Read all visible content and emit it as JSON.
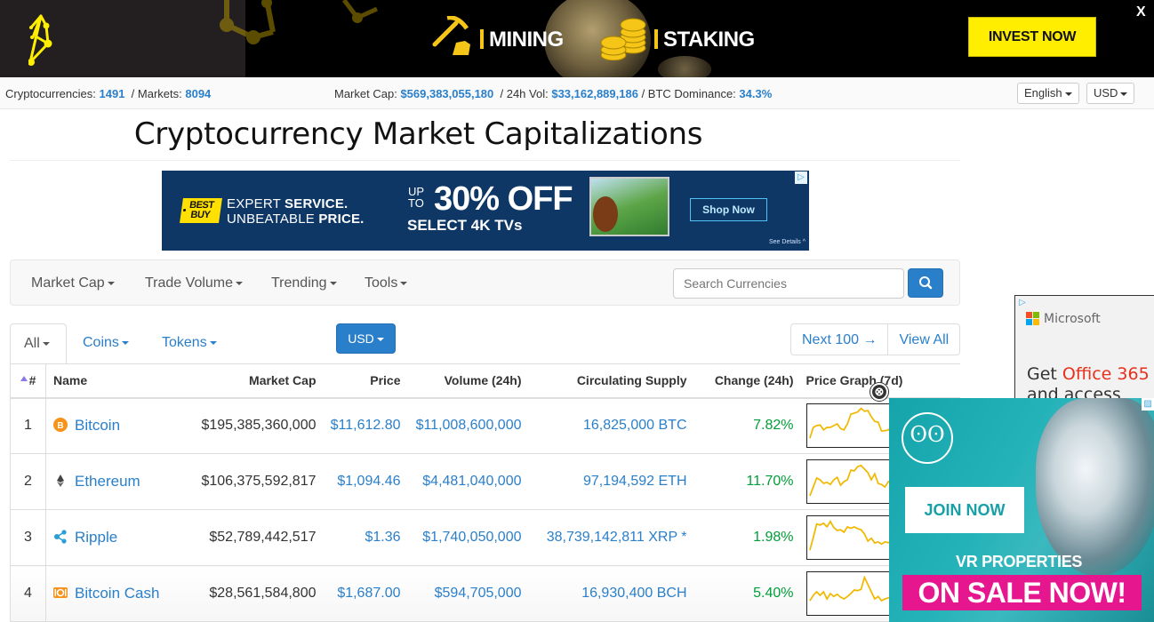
{
  "top_ad": {
    "mining_label": "MINING",
    "staking_label": "STAKING",
    "cta_label": "INVEST NOW",
    "close_label": "X",
    "accent_color": "#ffee00"
  },
  "stats": {
    "cryptocurrencies_label": "Cryptocurrencies:",
    "cryptocurrencies_value": "1491",
    "markets_label": "/ Markets:",
    "markets_value": "8094",
    "market_cap_label": "Market Cap:",
    "market_cap_value": "$569,383,055,180",
    "vol_label": "/ 24h Vol:",
    "vol_value": "$33,162,889,186",
    "btc_dom_label": "/ BTC Dominance:",
    "btc_dom_value": "34.3%",
    "language_selected": "English",
    "currency_selected": "USD"
  },
  "page_title": "Cryptocurrency Market Capitalizations",
  "bestbuy_ad": {
    "brand_line1": "BEST",
    "brand_line2": "BUY",
    "tagline_line1_light": "EXPERT ",
    "tagline_line1_bold": "SERVICE.",
    "tagline_line2_light": "UNBEATABLE ",
    "tagline_line2_bold": "PRICE.",
    "up_to": "UP TO",
    "discount": "30% OFF",
    "product": "SELECT 4K TVs",
    "cta": "Shop Now",
    "see_details": "See Details ^"
  },
  "nav": {
    "items": [
      {
        "label": "Market Cap"
      },
      {
        "label": "Trade Volume"
      },
      {
        "label": "Trending"
      },
      {
        "label": "Tools"
      }
    ],
    "search_placeholder": "Search Currencies"
  },
  "filters": {
    "tabs": [
      {
        "label": "All",
        "active": true
      },
      {
        "label": "Coins",
        "active": false
      },
      {
        "label": "Tokens",
        "active": false
      }
    ],
    "currency_button": "USD",
    "next_label": "Next 100 →",
    "view_all_label": "View All"
  },
  "table": {
    "columns": [
      "#",
      "Name",
      "Market Cap",
      "Price",
      "Volume (24h)",
      "Circulating Supply",
      "Change (24h)",
      "Price Graph (7d)"
    ],
    "rows": [
      {
        "rank": "1",
        "name": "Bitcoin",
        "icon": "bitcoin-icon",
        "market_cap": "$195,385,360,000",
        "price": "$11,612.80",
        "volume": "$11,008,600,000",
        "supply": "16,825,000 BTC",
        "change": "7.82%",
        "spark": [
          0.15,
          0.45,
          0.5,
          0.52,
          0.38,
          0.45,
          0.45,
          0.5,
          0.55,
          0.42,
          0.38,
          0.55,
          0.82,
          0.85,
          0.88,
          0.98,
          0.9,
          0.92,
          0.75,
          0.62,
          0.6,
          0.35,
          0.36,
          0.38,
          0.48
        ]
      },
      {
        "rank": "2",
        "name": "Ethereum",
        "icon": "ethereum-icon",
        "market_cap": "$106,375,592,817",
        "price": "$1,094.46",
        "volume": "$4,481,040,000",
        "supply": "97,194,592 ETH",
        "change": "11.70%",
        "spark": [
          0.1,
          0.35,
          0.6,
          0.55,
          0.45,
          0.48,
          0.42,
          0.55,
          0.62,
          0.4,
          0.5,
          0.55,
          0.82,
          0.8,
          0.92,
          0.95,
          0.85,
          0.75,
          0.55,
          0.72,
          0.45,
          0.42,
          0.35,
          0.5,
          0.55
        ]
      },
      {
        "rank": "3",
        "name": "Ripple",
        "icon": "ripple-icon",
        "market_cap": "$52,789,442,517",
        "price": "$1.36",
        "volume": "$1,740,050,000",
        "supply": "38,739,142,811 XRP *",
        "change": "1.98%",
        "spark": [
          0.15,
          0.5,
          0.88,
          0.85,
          0.9,
          0.8,
          0.95,
          0.78,
          0.7,
          0.72,
          0.65,
          0.8,
          0.76,
          0.8,
          0.75,
          0.72,
          0.6,
          0.4,
          0.48,
          0.35,
          0.38,
          0.32,
          0.38,
          0.36,
          0.4
        ]
      },
      {
        "rank": "4",
        "name": "Bitcoin Cash",
        "icon": "bitcoin-cash-icon",
        "market_cap": "$28,561,584,800",
        "price": "$1,687.00",
        "volume": "$594,705,000",
        "supply": "16,930,400 BCH",
        "change": "5.40%",
        "spark": [
          0.3,
          0.45,
          0.55,
          0.45,
          0.55,
          0.35,
          0.5,
          0.42,
          0.48,
          0.4,
          0.35,
          0.42,
          0.5,
          0.6,
          0.58,
          0.62,
          0.95,
          0.75,
          0.55,
          0.35,
          0.42,
          0.3,
          0.35,
          0.38,
          0.42
        ]
      }
    ],
    "positive_color": "#009e38",
    "spark_color": "#f2b800"
  },
  "microsoft_ad": {
    "brand": "Microsoft",
    "get": "Get ",
    "product": "Office 365",
    "line2": "and access"
  },
  "vr_ad": {
    "cta": "JOIN NOW",
    "headline": "VR PROPERTIES",
    "banner": "ON SALE NOW!",
    "close_label": "⊗"
  }
}
